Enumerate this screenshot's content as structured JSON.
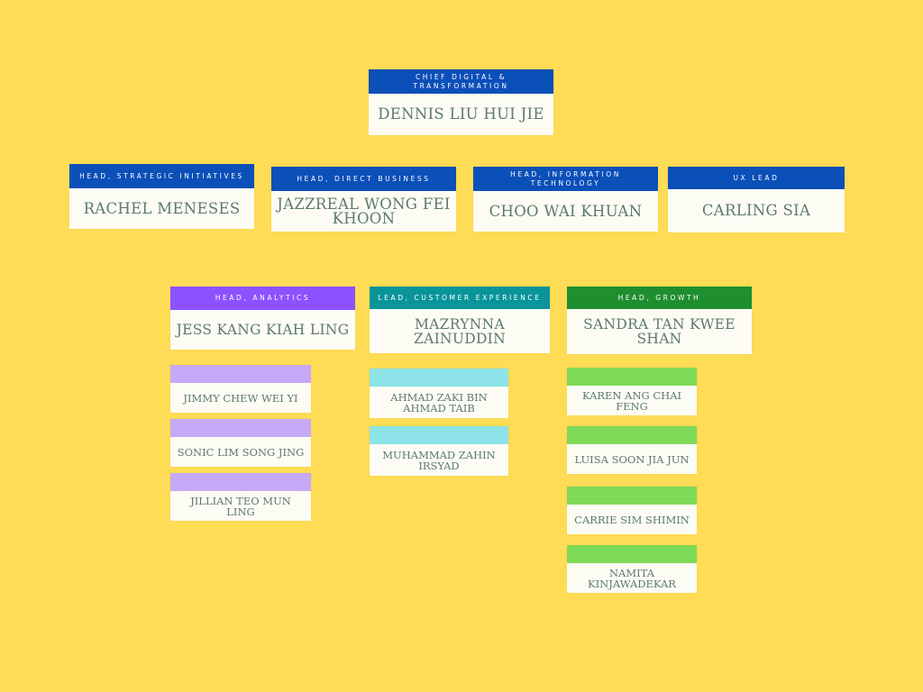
{
  "ceo": {
    "title": "CHIEF DIGITAL & TRANSFORMATION",
    "name": "DENNIS LIU HUI JIE"
  },
  "heads": [
    {
      "title": "HEAD, STRATEGIC INITIATIVES",
      "name": "RACHEL MENESES"
    },
    {
      "title": "HEAD, DIRECT BUSINESS",
      "name": "JAZZREAL WONG FEI KHOON"
    },
    {
      "title": "HEAD, INFORMATION TECHNOLOGY",
      "name": "CHOO WAI KHUAN"
    },
    {
      "title": "UX LEAD",
      "name": "CARLING SIA"
    }
  ],
  "teams": [
    {
      "title": "HEAD, ANALYTICS",
      "name": "JESS KANG KIAH LING",
      "color": "#8C52FF",
      "member_color": "#C6A9F7",
      "members": [
        "JIMMY CHEW WEI YI",
        "SONIC LIM SONG JING",
        "JILLIAN TEO MUN LING"
      ]
    },
    {
      "title": "LEAD, CUSTOMER EXPERIENCE",
      "name": "MAZRYNNA ZAINUDDIN",
      "color": "#09949A",
      "member_color": "#8DE3E8",
      "members": [
        "AHMAD ZAKI BIN AHMAD TAIB",
        "MUHAMMAD ZAHIN IRSYAD"
      ]
    },
    {
      "title": "HEAD, GROWTH",
      "name": "SANDRA TAN KWEE SHAN",
      "color": "#1E8E2E",
      "member_color": "#7FDA58",
      "members": [
        "KAREN ANG CHAI FENG",
        "LUISA SOON JIA JUN",
        "CARRIE SIM SHIMIN",
        "NAMITA KINJAWADEKAR"
      ]
    }
  ],
  "colors": {
    "background": "#FFDC55",
    "header_blue": "#0B4FB8",
    "name_text": "#5C7A6B"
  }
}
